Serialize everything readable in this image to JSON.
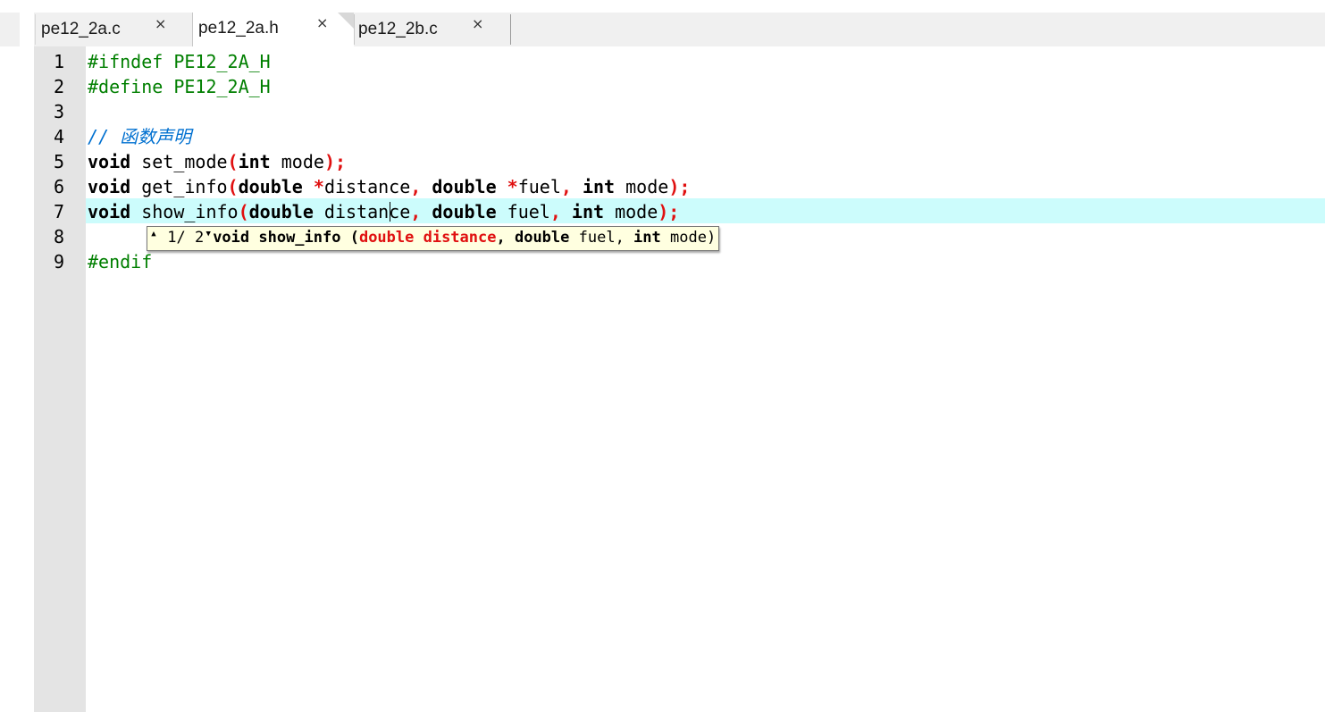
{
  "tabs": [
    {
      "label": "pe12_2a.c",
      "close": "×",
      "active": false
    },
    {
      "label": "pe12_2a.h",
      "close": "×",
      "active": true
    },
    {
      "label": "pe12_2b.c",
      "close": "×",
      "active": false
    }
  ],
  "editor": {
    "line_numbers": [
      "1",
      "2",
      "3",
      "4",
      "5",
      "6",
      "7",
      "8",
      "9"
    ],
    "current_line": 7,
    "lines": {
      "l1": "#ifndef PE12_2A_H",
      "l2": "#define PE12_2A_H",
      "l4": "// 函数声明",
      "l5": {
        "kw1": "void",
        "name": " set_mode",
        "p1": "(",
        "kw2": "int",
        "arg": " mode",
        "p2": ");"
      },
      "l6": {
        "kw1": "void",
        "name": " get_info",
        "p1": "(",
        "kw2": "double",
        "s1": " ",
        "star1": "*",
        "a1": "distance",
        "c1": ",",
        "s2": " ",
        "kw3": "double",
        "s3": " ",
        "star2": "*",
        "a2": "fuel",
        "c2": ",",
        "s4": " ",
        "kw4": "int",
        "a3": " mode",
        "p2": ");"
      },
      "l7": {
        "kw1": "void",
        "name": " show_info",
        "p1": "(",
        "kw2": "double",
        "a1": " distance",
        "c1": ",",
        "s1": " ",
        "kw3": "double",
        "a2": " fuel",
        "c2": ",",
        "s2": " ",
        "kw4": "int",
        "a3": " mode",
        "p2": ");"
      },
      "l9": "#endif"
    }
  },
  "calltip": {
    "up_arrow": "▲",
    "counter": " 1/ 2",
    "down_arrow": "▼",
    "pre": "void show_info (",
    "highlight": "double distance",
    "rest1": ", ",
    "type2": "double",
    "arg2": " fuel, ",
    "type3": "int",
    "arg3": " mode)"
  },
  "colors": {
    "preprocessor": "#007f00",
    "comment": "#0070d0",
    "operator": "#e01010",
    "caret_line": "#ccfcfc",
    "calltip_bg": "#ffffe0"
  }
}
